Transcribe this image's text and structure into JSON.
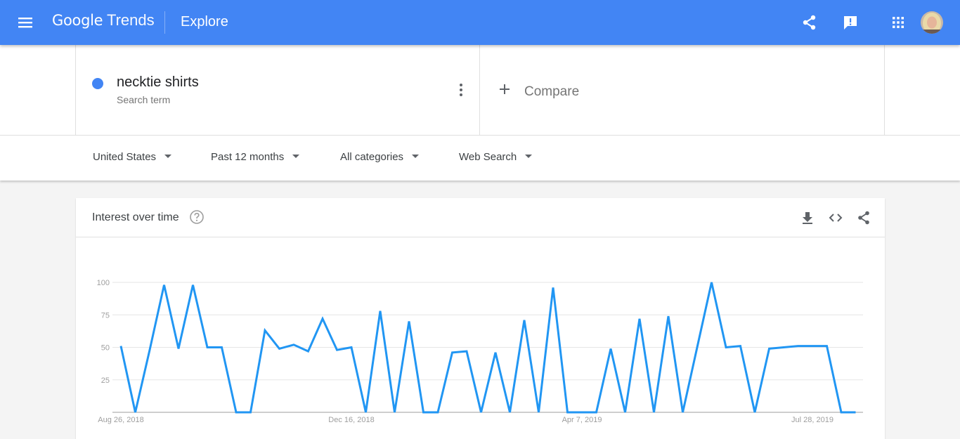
{
  "header": {
    "logo_google": "Google",
    "logo_trends": "Trends",
    "page_title": "Explore"
  },
  "search": {
    "term": "necktie shirts",
    "term_type": "Search term",
    "compare_label": "Compare",
    "term_color": "#4285f4"
  },
  "filters": {
    "region": "United States",
    "time_range": "Past 12 months",
    "category": "All categories",
    "search_type": "Web Search"
  },
  "card": {
    "title": "Interest over time"
  },
  "colors": {
    "header_bg": "#4285f4",
    "series_line": "#2196f3"
  },
  "chart_data": {
    "type": "line",
    "title": "Interest over time",
    "xlabel": "",
    "ylabel": "",
    "ylim": [
      0,
      100
    ],
    "yticks": [
      25,
      50,
      75,
      100
    ],
    "x_tick_labels": [
      "Aug 26, 2018",
      "Dec 16, 2018",
      "Apr 7, 2019",
      "Jul 28, 2019"
    ],
    "x_tick_indices": [
      0,
      16,
      32,
      48
    ],
    "grid": true,
    "series": [
      {
        "name": "necktie shirts",
        "values": [
          51,
          0,
          48,
          98,
          49,
          98,
          50,
          50,
          0,
          0,
          63,
          49,
          52,
          47,
          72,
          48,
          50,
          0,
          78,
          0,
          70,
          0,
          0,
          46,
          47,
          0,
          46,
          0,
          71,
          0,
          96,
          0,
          0,
          0,
          49,
          0,
          72,
          0,
          74,
          0,
          50,
          100,
          50,
          51,
          0,
          49,
          50,
          51,
          51,
          51,
          0,
          0
        ]
      }
    ]
  }
}
